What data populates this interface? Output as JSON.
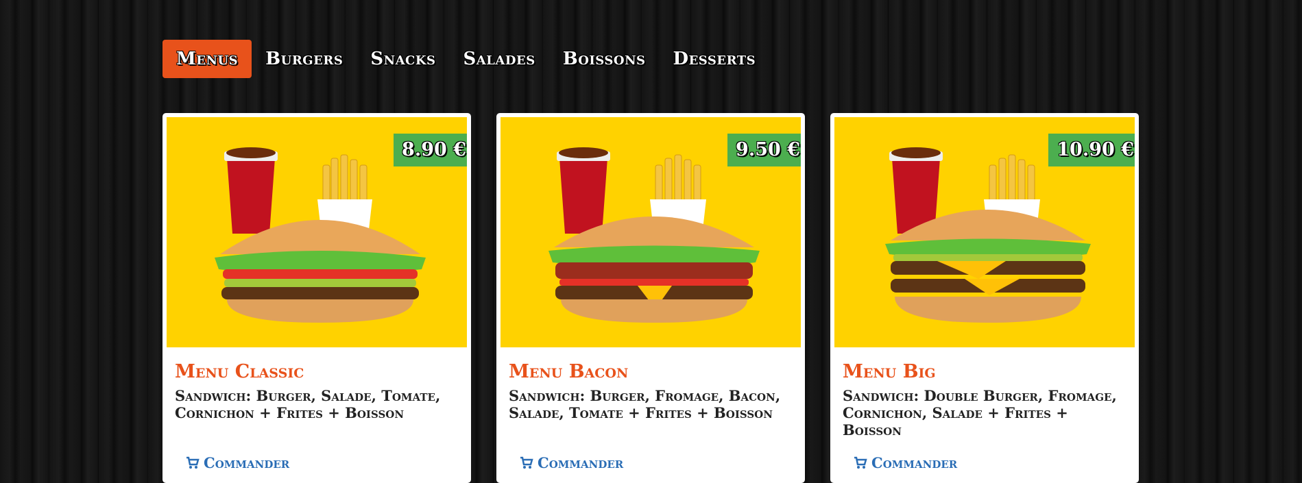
{
  "nav": {
    "items": [
      {
        "label": "Menus",
        "active": true
      },
      {
        "label": "Burgers",
        "active": false
      },
      {
        "label": "Snacks",
        "active": false
      },
      {
        "label": "Salades",
        "active": false
      },
      {
        "label": "Boissons",
        "active": false
      },
      {
        "label": "Desserts",
        "active": false
      }
    ]
  },
  "cards": [
    {
      "price": "8.90 €",
      "title": "Menu Classic",
      "description": "Sandwich: Burger, Salade, Tomate, Cornichon + Frites + Boisson",
      "order_label": "Commander",
      "image": "menu-classic-photo"
    },
    {
      "price": "9.50 €",
      "title": "Menu Bacon",
      "description": "Sandwich: Burger, Fromage, Bacon, Salade, Tomate + Frites + Boisson",
      "order_label": "Commander",
      "image": "menu-bacon-photo"
    },
    {
      "price": "10.90 €",
      "title": "Menu Big",
      "description": "Sandwich: Double Burger, Fromage, Cornichon, Salade + Frites + Boisson",
      "order_label": "Commander",
      "image": "menu-big-photo"
    }
  ],
  "colors": {
    "accent": "#e8521b",
    "price_badge": "#4cae4f",
    "image_bg": "#ffd200",
    "link": "#2a6db5"
  }
}
